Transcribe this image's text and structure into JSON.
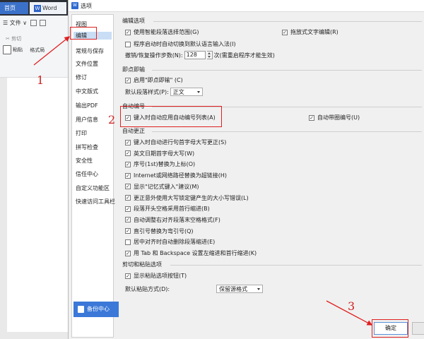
{
  "background_app": {
    "tabs": [
      "首页",
      "Word"
    ],
    "menu": "☰ 文件 ∨",
    "cut": "✂ 剪切",
    "paste": "粘贴",
    "format": "格式局"
  },
  "dialog": {
    "title": "选项",
    "title_icon_letter": "W",
    "sidebar": {
      "items": [
        "视图",
        "编辑",
        "常规与保存",
        "文件位置",
        "修订",
        "中文版式",
        "输出PDF",
        "用户信息",
        "打印",
        "拼写检查",
        "安全性",
        "信任中心",
        "自定义功能区",
        "快速访问工具栏"
      ],
      "active": "编辑",
      "backup_label": "备份中心"
    },
    "sections": {
      "edit_options": {
        "title": "编辑选项",
        "smart_select": "使用智能段落选择范围(G)",
        "drag_text": "拖放式文字编辑(R)",
        "ime_switch": "程序启动时自动切换到默认语言输入法(I)",
        "undo_label": "撤销/恢复操作步数(N):",
        "undo_value": "128",
        "undo_note": "次(需重启程序才能生效)"
      },
      "click_typing": {
        "title": "即点即输",
        "enable": "启用\"即点即输\" (C)",
        "default_style_label": "默认段落样式(P):",
        "default_style_value": "正文"
      },
      "auto_numbering": {
        "title": "自动编号",
        "apply_when_typing": "键入时自动应用自动编号列表(A)",
        "auto_bullets": "自动带圈编号(U)"
      },
      "auto_correct": {
        "title": "自动更正",
        "items": [
          "键入时自动进行句首字母大写更正(S)",
          "英文日期首字母大写(W)",
          "序号(1st)替换为上标(O)",
          "Internet或网络路径替换为超链接(H)",
          "显示\"记忆式键入\"建议(M)",
          "更正意外使用大写锁定键产生的大小写错误(L)",
          "段落开头空格采用首行缩进(B)",
          "自动调整右对齐段落末空格格式(F)",
          "直引号替换为弯引号(Q)",
          "居中对齐时自动删除段落缩进(E)",
          "用 Tab 和 Backspace 设置左缩进和首行缩进(K)"
        ],
        "checked": [
          true,
          true,
          true,
          true,
          true,
          true,
          true,
          true,
          true,
          false,
          true
        ]
      },
      "cut_paste": {
        "title": "剪切和粘贴选项",
        "show_button": "显示粘贴选项按钮(T)",
        "default_paste_label": "默认粘贴方式(D):",
        "default_paste_value": "保留源格式"
      }
    },
    "ok_label": "确定"
  },
  "annotations": {
    "step1": "1",
    "step2": "2",
    "step3": "3",
    "color": "#e02020"
  }
}
